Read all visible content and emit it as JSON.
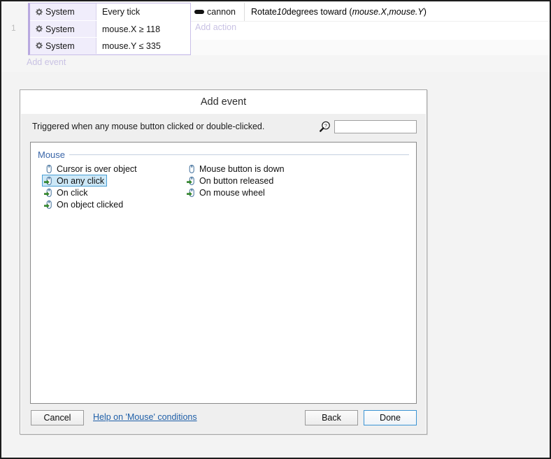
{
  "event_sheet": {
    "row_number": "1",
    "conditions": [
      {
        "object": "System",
        "icon": "gear-icon",
        "text": "Every tick"
      },
      {
        "object": "System",
        "icon": "gear-icon",
        "text": "mouse.X ≥ 118"
      },
      {
        "object": "System",
        "icon": "gear-icon",
        "text": "mouse.Y ≤ 335"
      }
    ],
    "action": {
      "object": "cannon",
      "icon": "cannon-icon",
      "text_prefix": "Rotate ",
      "text_value": "10",
      "text_mid": " degrees toward (",
      "param_x": "mouse.X",
      "param_sep": ", ",
      "param_y": "mouse.Y",
      "text_suffix": ")"
    },
    "add_action_label": "Add action",
    "add_event_label": "Add event"
  },
  "dialog": {
    "title": "Add event",
    "description": "Triggered when any mouse button clicked or double-clicked.",
    "search": {
      "icon": "search-help-icon",
      "value": "",
      "placeholder": ""
    },
    "groups": [
      {
        "title": "Mouse",
        "items": [
          {
            "label": "Cursor is over object",
            "icon": "mouse-condition-icon",
            "type": "condition",
            "selected": false
          },
          {
            "label": "Mouse button is down",
            "icon": "mouse-condition-icon",
            "type": "condition",
            "selected": false
          },
          {
            "label": "On any click",
            "icon": "mouse-trigger-icon",
            "type": "trigger",
            "selected": true
          },
          {
            "label": "On button released",
            "icon": "mouse-trigger-icon",
            "type": "trigger",
            "selected": false
          },
          {
            "label": "On click",
            "icon": "mouse-trigger-icon",
            "type": "trigger",
            "selected": false
          },
          {
            "label": "On mouse wheel",
            "icon": "mouse-trigger-icon",
            "type": "trigger",
            "selected": false
          },
          {
            "label": "On object clicked",
            "icon": "mouse-trigger-icon",
            "type": "trigger",
            "selected": false
          }
        ]
      }
    ],
    "footer": {
      "cancel_label": "Cancel",
      "help_label": "Help on 'Mouse' conditions",
      "back_label": "Back",
      "done_label": "Done"
    }
  },
  "colors": {
    "event_block_bg": "#f0edfb",
    "event_block_border": "#b9a9e0",
    "add_link": "#c9c2e4",
    "group_title": "#3a66a8",
    "selection_bg": "#cde8f7",
    "selection_border": "#4a9fd4",
    "link": "#1f5fa8",
    "done_focus_border": "#3c94d4"
  }
}
